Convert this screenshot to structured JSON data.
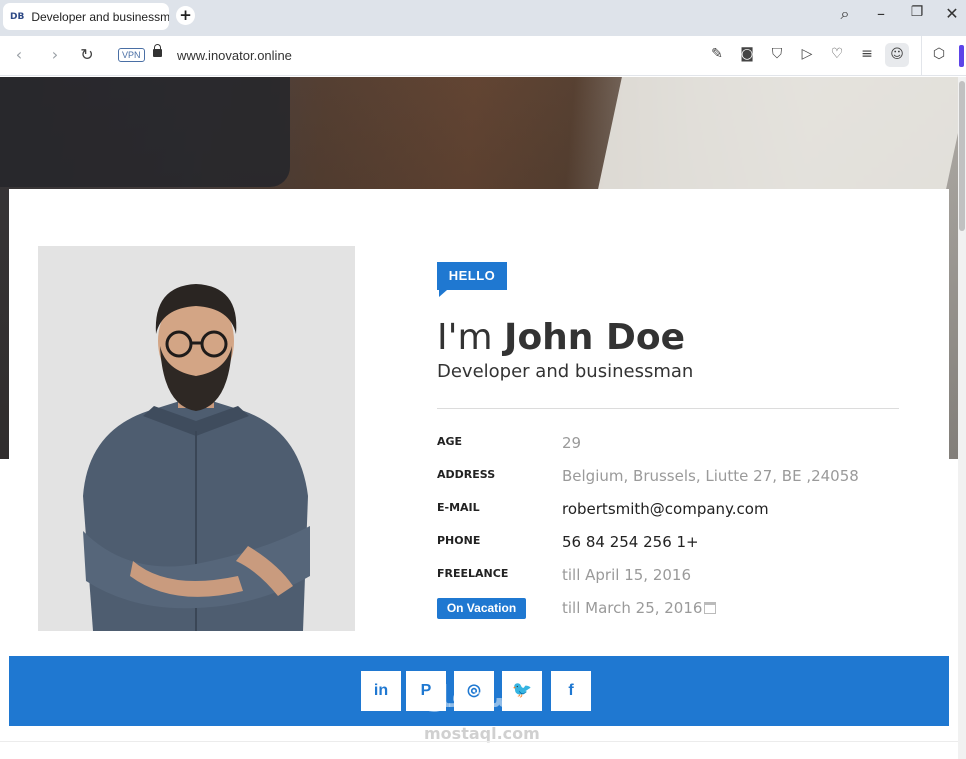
{
  "browser": {
    "tab": {
      "favicon_text": "DB",
      "title": "Developer and businessm"
    },
    "url": "www.inovator.online",
    "vpn_label": "VPN"
  },
  "profile": {
    "badge": "HELLO",
    "intro": "I'm",
    "name": "John Doe",
    "role": "Developer and businessman",
    "info": [
      {
        "label": "AGE",
        "value": "29"
      },
      {
        "label": "ADDRESS",
        "value": "Belgium, Brussels, Liutte 27, BE ,24058"
      },
      {
        "label": "E-MAIL",
        "value": "robertsmith@company.com"
      },
      {
        "label": "PHONE",
        "value": "56 84 254 256 1+"
      },
      {
        "label": "FREELANCE",
        "value": "till April 15, 2016"
      }
    ],
    "vacation": {
      "label": "On Vacation",
      "value": "till March 25, 2016"
    }
  },
  "social": [
    "in",
    "P",
    "◎",
    "🐦",
    "f"
  ],
  "watermark": {
    "arabic": "مستقل",
    "latin": "mostaql.com"
  },
  "colors": {
    "accent": "#1f78d1",
    "browser_bar": "#dee3ea"
  },
  "icons": [
    "back-icon",
    "forward-icon",
    "reload-icon",
    "lock-icon",
    "edit-icon",
    "camera-icon",
    "shield-icon",
    "send-icon",
    "heart-icon",
    "menu-icon",
    "profile-icon",
    "cube-icon",
    "calendar-icon"
  ]
}
